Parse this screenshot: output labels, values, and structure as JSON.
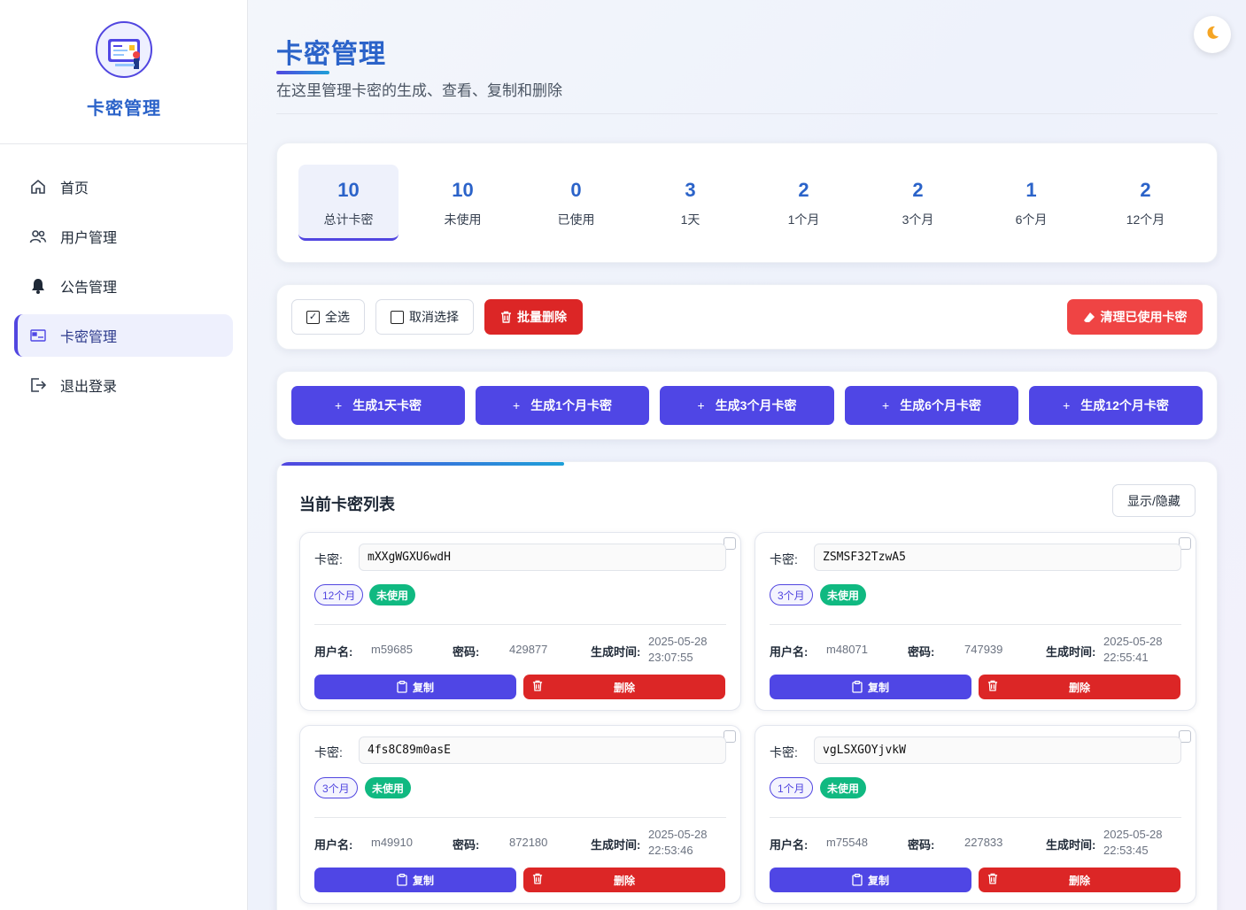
{
  "sidebar": {
    "brand_title": "卡密管理",
    "items": [
      {
        "label": "首页",
        "icon": "home-icon"
      },
      {
        "label": "用户管理",
        "icon": "users-icon"
      },
      {
        "label": "公告管理",
        "icon": "bell-icon"
      },
      {
        "label": "卡密管理",
        "icon": "card-icon",
        "active": true
      },
      {
        "label": "退出登录",
        "icon": "logout-icon"
      }
    ]
  },
  "header": {
    "title": "卡密管理",
    "subtitle": "在这里管理卡密的生成、查看、复制和删除"
  },
  "stats": [
    {
      "value": "10",
      "label": "总计卡密",
      "active": true
    },
    {
      "value": "10",
      "label": "未使用"
    },
    {
      "value": "0",
      "label": "已使用"
    },
    {
      "value": "3",
      "label": "1天"
    },
    {
      "value": "2",
      "label": "1个月"
    },
    {
      "value": "2",
      "label": "3个月"
    },
    {
      "value": "1",
      "label": "6个月"
    },
    {
      "value": "2",
      "label": "12个月"
    }
  ],
  "actions": {
    "select_all": "全选",
    "deselect": "取消选择",
    "batch_delete": "批量删除",
    "clear_used": "清理已使用卡密"
  },
  "generate": [
    {
      "label": "生成1天卡密"
    },
    {
      "label": "生成1个月卡密"
    },
    {
      "label": "生成3个月卡密"
    },
    {
      "label": "生成6个月卡密"
    },
    {
      "label": "生成12个月卡密"
    }
  ],
  "list": {
    "title": "当前卡密列表",
    "toggle": "显示/隐藏",
    "labels": {
      "code": "卡密:",
      "username": "用户名:",
      "password": "密码:",
      "created": "生成时间:",
      "copy": "复制",
      "delete": "删除"
    },
    "cards": [
      {
        "code": "mXXgWGXU6wdH",
        "duration": "12个月",
        "status": "未使用",
        "username": "m59685",
        "password": "429877",
        "date": "2025-05-28",
        "time": "23:07:55"
      },
      {
        "code": "ZSMSF32TzwA5",
        "duration": "3个月",
        "status": "未使用",
        "username": "m48071",
        "password": "747939",
        "date": "2025-05-28",
        "time": "22:55:41"
      },
      {
        "code": "4fs8C89m0asE",
        "duration": "3个月",
        "status": "未使用",
        "username": "m49910",
        "password": "872180",
        "date": "2025-05-28",
        "time": "22:53:46"
      },
      {
        "code": "vgLSXGOYjvkW",
        "duration": "1个月",
        "status": "未使用",
        "username": "m75548",
        "password": "227833",
        "date": "2025-05-28",
        "time": "22:53:45"
      }
    ]
  },
  "colors": {
    "accent": "#4f46e5",
    "title_blue": "#2b63c9",
    "danger": "#dc2626",
    "success": "#10b981"
  }
}
